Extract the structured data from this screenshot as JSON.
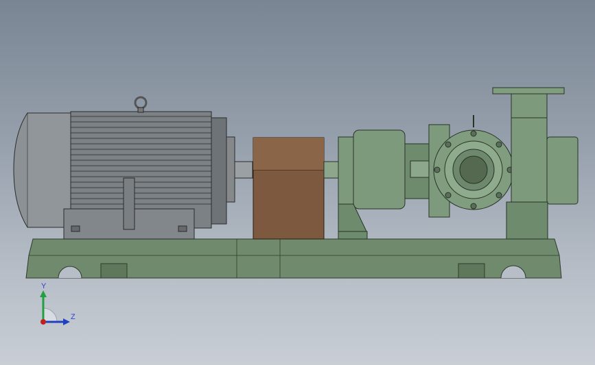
{
  "viewport": {
    "background_top": "#7a8594",
    "background_bottom": "#c9ced5"
  },
  "model": {
    "parts": [
      "electric-motor",
      "coupling-guard",
      "pump-bearing-housing",
      "pump-casing",
      "suction-flange",
      "discharge-flange",
      "baseplate"
    ],
    "colors": {
      "motor": "#8a8f92",
      "coupling_guard": "#7d5a3f",
      "pump": "#7e9a7d",
      "baseplate": "#6f8a6c"
    }
  },
  "triad": {
    "y_label": "Y",
    "z_label": "Z",
    "y_color": "#20a040",
    "z_color": "#2040c0",
    "origin_color": "#c02020"
  }
}
